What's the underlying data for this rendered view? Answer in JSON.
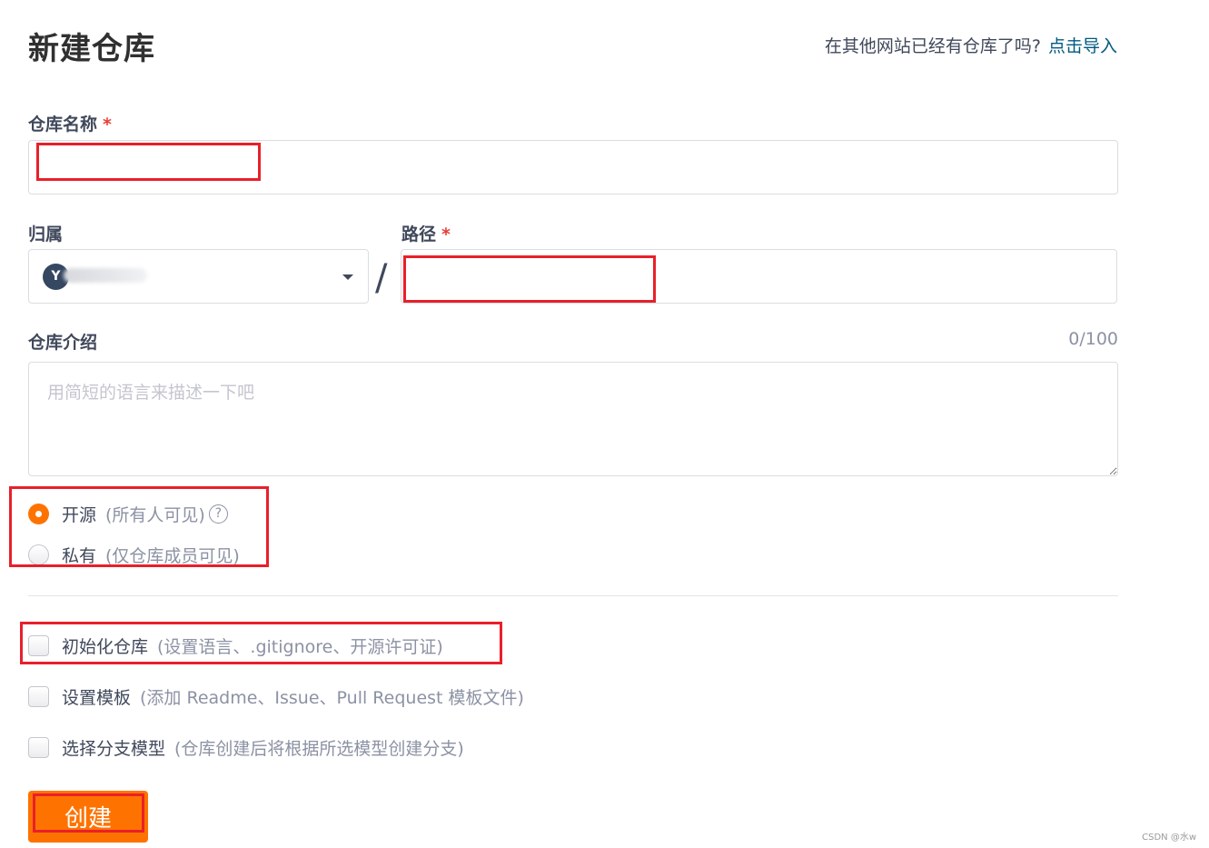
{
  "header": {
    "title": "新建仓库",
    "import_prompt": "在其他网站已经有仓库了吗?",
    "import_link": "点击导入"
  },
  "form": {
    "repo_name": {
      "label": "仓库名称",
      "required_mark": "*",
      "value": ""
    },
    "owner": {
      "label": "归属",
      "avatar_letter": "Y",
      "value": "yantianzi (blurred)"
    },
    "separator": "/",
    "path": {
      "label": "路径",
      "required_mark": "*",
      "value": ""
    },
    "description": {
      "label": "仓库介绍",
      "counter": "0/100",
      "placeholder": "用简短的语言来描述一下吧",
      "value": ""
    },
    "visibility": {
      "options": [
        {
          "label": "开源",
          "hint": "(所有人可见)",
          "checked": true,
          "has_help": true
        },
        {
          "label": "私有",
          "hint": "(仅仓库成员可见)",
          "checked": false,
          "has_help": false
        }
      ]
    },
    "extras": [
      {
        "label": "初始化仓库",
        "hint": "(设置语言、.gitignore、开源许可证)",
        "checked": false
      },
      {
        "label": "设置模板",
        "hint": "(添加 Readme、Issue、Pull Request 模板文件)",
        "checked": false
      },
      {
        "label": "选择分支模型",
        "hint": "(仓库创建后将根据所选模型创建分支)",
        "checked": false
      }
    ],
    "submit_label": "创建"
  },
  "icons": {
    "help": "?",
    "caret": "caret-down-icon"
  },
  "colors": {
    "accent": "#fe7300",
    "link": "#005980",
    "required": "#e63e36",
    "annotation": "#e8202a"
  },
  "watermark": "CSDN @水w"
}
